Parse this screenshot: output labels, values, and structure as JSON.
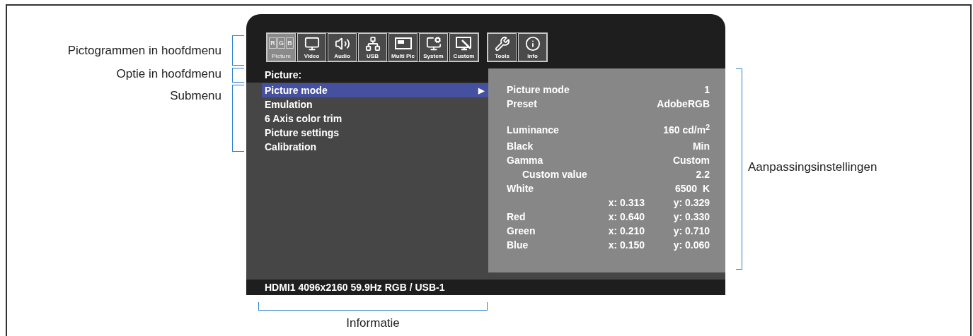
{
  "callouts": {
    "main_icons": "Pictogrammen in hoofdmenu",
    "main_option": "Optie in hoofdmenu",
    "submenu": "Submenu",
    "adjustments": "Aanpassingsinstellingen",
    "information": "Informatie"
  },
  "osd": {
    "icon_groups": [
      [
        {
          "kind": "rgb",
          "label": "Picture",
          "glyphs": [
            "R",
            "G",
            "B"
          ],
          "selected": true
        },
        {
          "kind": "monitor",
          "label": "Video",
          "selected": false
        },
        {
          "kind": "speaker",
          "label": "Audio",
          "selected": false
        },
        {
          "kind": "usb",
          "label": "USB",
          "selected": false
        },
        {
          "kind": "multipic",
          "label": "Multi Pic",
          "selected": false
        },
        {
          "kind": "system",
          "label": "System",
          "selected": false
        },
        {
          "kind": "custom",
          "label": "Custom",
          "selected": false
        }
      ],
      [
        {
          "kind": "tools",
          "label": "Tools",
          "selected": false
        },
        {
          "kind": "info",
          "label": "Info",
          "selected": false
        }
      ]
    ],
    "menu_title": "Picture:",
    "submenu": [
      {
        "label": "Picture mode",
        "arrow": "▶",
        "selected": true
      },
      {
        "label": "Emulation",
        "selected": false
      },
      {
        "label": "6 Axis color trim",
        "selected": false
      },
      {
        "label": "Picture settings",
        "selected": false
      },
      {
        "label": "Calibration",
        "selected": false
      }
    ],
    "settings": [
      {
        "label": "Picture mode",
        "value": "1"
      },
      {
        "label": "Preset",
        "value": "AdobeRGB"
      },
      {
        "label": "Luminance",
        "value": "160 cd/m$^{2}$",
        "gap_before": true
      },
      {
        "label": "Black",
        "value": "Min"
      },
      {
        "label": "Gamma",
        "value": "Custom"
      },
      {
        "label": "Custom value",
        "value": "2.2",
        "indent": true
      },
      {
        "label": "White",
        "value": "6500  K"
      },
      {
        "x": "x: 0.313",
        "value": "y: 0.329"
      },
      {
        "label": "Red",
        "x": "x: 0.640",
        "value": "y: 0.330"
      },
      {
        "label": "Green",
        "x": "x: 0.210",
        "value": "y: 0.710"
      },
      {
        "label": "Blue",
        "x": "x: 0.150",
        "value": "y: 0.060"
      }
    ],
    "info_bar": "HDMI1 4096x2160 59.9Hz RGB / USB-1"
  }
}
